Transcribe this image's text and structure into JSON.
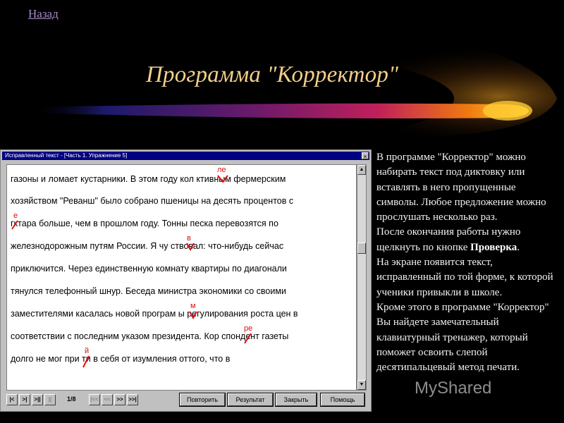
{
  "nav": {
    "back_label": "Назад"
  },
  "slide": {
    "title": "Программа \"Корректор\""
  },
  "app": {
    "window_title": "Исправленный текст - [Часть 1. Упражнение 5]",
    "close_glyph": "×",
    "lines": [
      "газоны и ломает кустарники.  В этом году кол    ктивным фермерским",
      "хозяйством \"Реванш\" было собрано пшеницы на десять процентов с",
      " гктара больше, чем в прошлом году.  Тонны песка перевозятся по",
      "железнодорожным путям России.  Я чу   ствовал: что-нибудь сейчас",
      "приключится.  Через единственную комнату квартиры по диагонали",
      "тянулся телефонный шнур.  Беседа министра экономики со своими",
      "заместителями касалась новой програм   ы регулирования роста цен в",
      "соответствии с последним указом президента.  Кор    спондент газеты",
      "долго не мог при  ти в себя от изумления оттого, что в"
    ],
    "corrections": [
      "ле",
      "е",
      "в",
      "м",
      "ре",
      "й"
    ],
    "page_indicator": "1/8",
    "nav_buttons": [
      "|<",
      ">|",
      ">||",
      "||",
      "|<<",
      "<<",
      ">>",
      ">>|"
    ],
    "buttons": {
      "repeat": "Повторить",
      "result": "Результат",
      "close": "Закрыть",
      "help": "Помощь"
    }
  },
  "description": {
    "p1": "В программе \"Корректор\" можно набирать текст под диктовку или вставлять в него пропущенные символы. Любое предложение можно прослушать несколько раз.",
    "p2_before": "После окончания работы нужно щелкнуть по кнопке ",
    "p2_bold": "Проверка",
    "p2_after": ".",
    "p3": "На экране появится текст, исправленный по той форме, к которой ученики привыкли в школе.",
    "p4": "Кроме этого в программе \"Корректор\" Вы найдете замечательный клавиатурный тренажер, который поможет освоить слепой десятипальцевый метод печати."
  },
  "watermark": "MyShared"
}
